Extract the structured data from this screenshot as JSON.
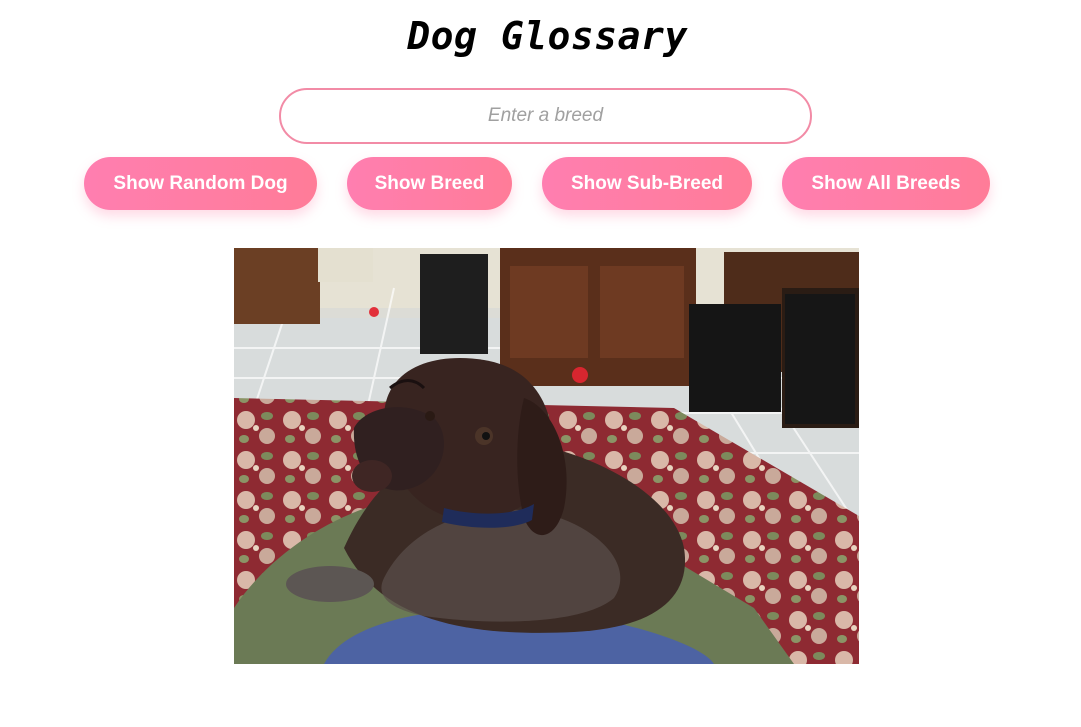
{
  "header": {
    "title": "Dog Glossary"
  },
  "search": {
    "placeholder": "Enter a breed",
    "value": ""
  },
  "buttons": {
    "random": "Show Random Dog",
    "breed": "Show Breed",
    "sub_breed": "Show Sub-Breed",
    "all_breeds": "Show All Breeds"
  },
  "colors": {
    "accent": "#ff7ca8",
    "input_border": "#f28ba6",
    "button_text": "#ffffff"
  },
  "icons": {
    "photo": "dog-photo"
  }
}
